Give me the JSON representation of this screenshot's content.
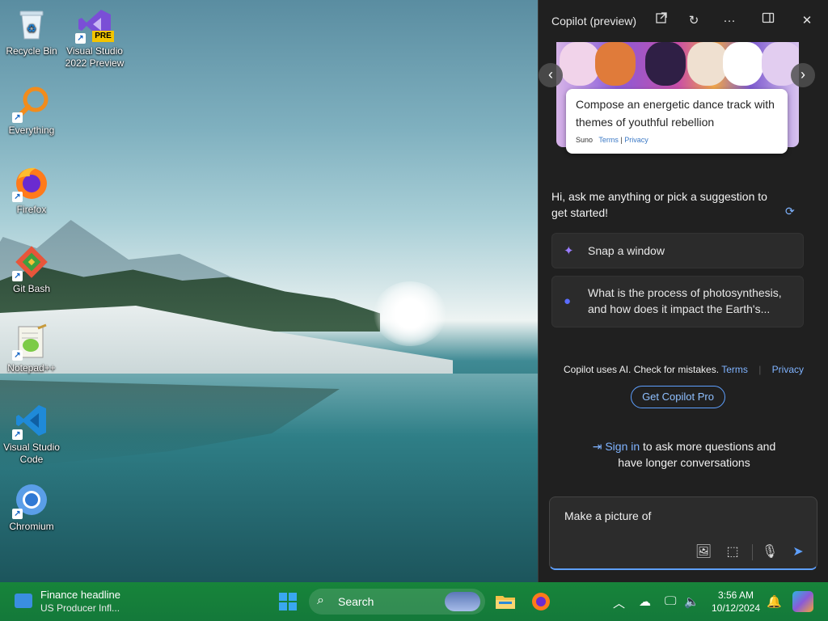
{
  "desktop": {
    "icons": [
      {
        "label": "Recycle Bin",
        "icon": "recycle-bin-icon"
      },
      {
        "label": "Visual Studio 2022 Preview",
        "icon": "visual-studio-icon",
        "badge": "PRE"
      },
      {
        "label": "Everything",
        "icon": "search-magnifier-icon"
      },
      {
        "label": "Firefox",
        "icon": "firefox-icon"
      },
      {
        "label": "Git Bash",
        "icon": "git-icon"
      },
      {
        "label": "Notepad++",
        "icon": "notepad-plus-plus-icon"
      },
      {
        "label": "Visual Studio Code",
        "icon": "vscode-icon"
      },
      {
        "label": "Chromium",
        "icon": "chromium-icon"
      }
    ]
  },
  "copilot": {
    "title": "Copilot (preview)",
    "carousel": {
      "prompt": "Compose an energetic dance track with themes of youthful rebellion",
      "provider": "Suno",
      "terms": "Terms",
      "separator": "|",
      "privacy": "Privacy"
    },
    "greeting": "Hi, ask me anything or pick a suggestion to get started!",
    "suggestions": [
      {
        "label": "Snap a window",
        "icon": "sparkle-icon"
      },
      {
        "label": "What is the process of photosynthesis, and how does it impact the Earth's...",
        "icon": "chat-bubble-icon"
      }
    ],
    "disclaimer": {
      "text": "Copilot uses AI. Check for mistakes.",
      "terms": "Terms",
      "privacy": "Privacy"
    },
    "pro_button": "Get Copilot Pro",
    "signin": {
      "link": "Sign in",
      "text": "to ask more questions and have longer conversations"
    },
    "input": {
      "value": "Make a picture of"
    }
  },
  "taskbar": {
    "widget": {
      "title": "Finance headline",
      "subtitle": "US Producer Infl..."
    },
    "search_label": "Search",
    "clock": {
      "time": "3:56 AM",
      "date": "10/12/2024"
    }
  },
  "colors": {
    "panel_bg": "#202020",
    "accent": "#7fb3ff",
    "taskbar": "#17843a"
  }
}
